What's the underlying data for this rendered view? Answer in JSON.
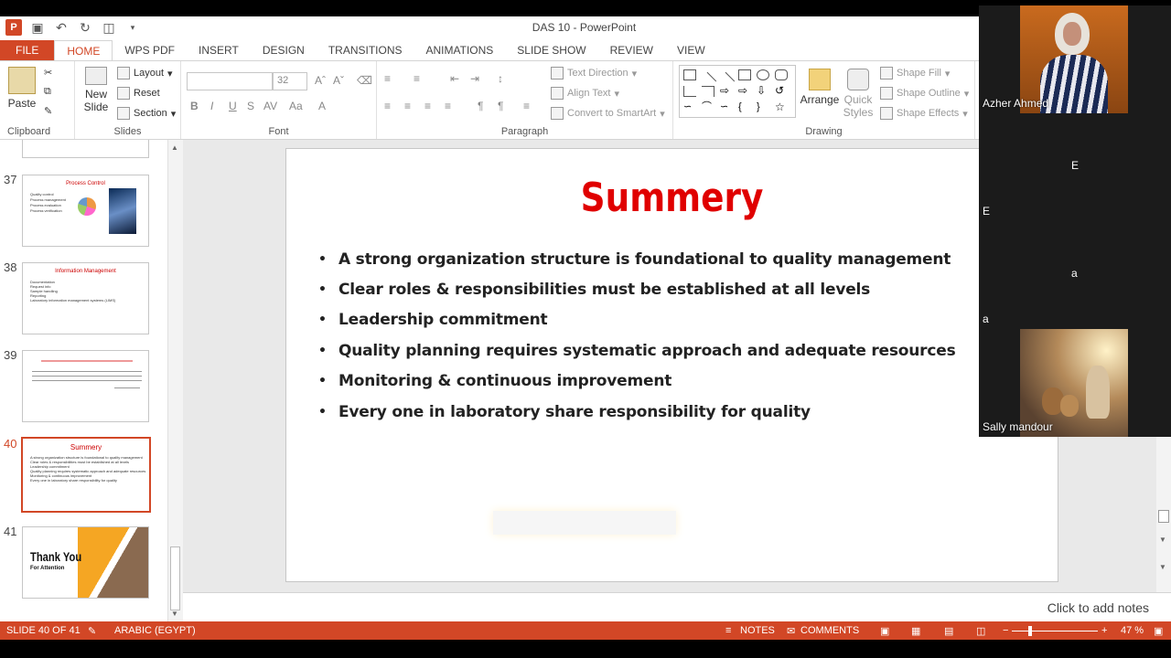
{
  "window": {
    "title": "DAS 10 - PowerPoint"
  },
  "tabs": [
    "FILE",
    "HOME",
    "WPS PDF",
    "INSERT",
    "DESIGN",
    "TRANSITIONS",
    "ANIMATIONS",
    "SLIDE SHOW",
    "REVIEW",
    "VIEW"
  ],
  "ribbon": {
    "clipboard": {
      "label": "Clipboard",
      "paste": "Paste"
    },
    "slides": {
      "label": "Slides",
      "new_slide": "New Slide",
      "layout": "Layout",
      "reset": "Reset",
      "section": "Section"
    },
    "font": {
      "label": "Font",
      "size": "32"
    },
    "paragraph": {
      "label": "Paragraph",
      "text_direction": "Text Direction",
      "align_text": "Align Text",
      "convert": "Convert to SmartArt"
    },
    "drawing": {
      "label": "Drawing",
      "arrange": "Arrange",
      "quick_styles": "Quick Styles",
      "shape_fill": "Shape Fill",
      "shape_outline": "Shape Outline",
      "shape_effects": "Shape Effects"
    }
  },
  "thumbnails": [
    {
      "num": "37",
      "title": "Process Control",
      "lines": [
        "Quality control",
        "Process management",
        "Process evaluation",
        "Process verification"
      ]
    },
    {
      "num": "38",
      "title": "Information Management",
      "lines": [
        "Documentation",
        "Request info",
        "Sample handling",
        "Reporting",
        "Laboratory information management systems (LIMS)"
      ]
    },
    {
      "num": "39",
      "title": "",
      "lines": []
    },
    {
      "num": "40",
      "title": "Summery",
      "lines": [
        "A strong organization structure is foundational to quality management",
        "Clear roles & responsibilities must be established at all levels",
        "Leadership commitment",
        "Quality planning requires systematic approach and adequate resources",
        "Monitoring & continuous improvement",
        "Every one in laboratory share responsibility for quality"
      ]
    },
    {
      "num": "41",
      "title": "Thank You",
      "subtitle": "For Attention"
    }
  ],
  "slide": {
    "title": "Summery",
    "bullets": [
      "A strong organization structure is foundational to quality management",
      "Clear roles & responsibilities must be established at all levels",
      "Leadership commitment",
      "Quality planning requires systematic approach and adequate resources",
      "Monitoring & continuous improvement",
      "Every one in laboratory share responsibility for quality"
    ]
  },
  "notes": {
    "placeholder": "Click to add notes"
  },
  "status": {
    "slide": "SLIDE 40 OF 41",
    "language": "ARABIC (EGYPT)",
    "notes": "NOTES",
    "comments": "COMMENTS",
    "zoom": "47 %"
  },
  "video": {
    "participants": [
      {
        "name": "Azher Ahmed"
      },
      {
        "name": "Sally mandour"
      }
    ],
    "letters": [
      "E",
      "E",
      "a",
      "a"
    ]
  },
  "colors": {
    "accent": "#d24726",
    "slide_title": "#e00000"
  }
}
